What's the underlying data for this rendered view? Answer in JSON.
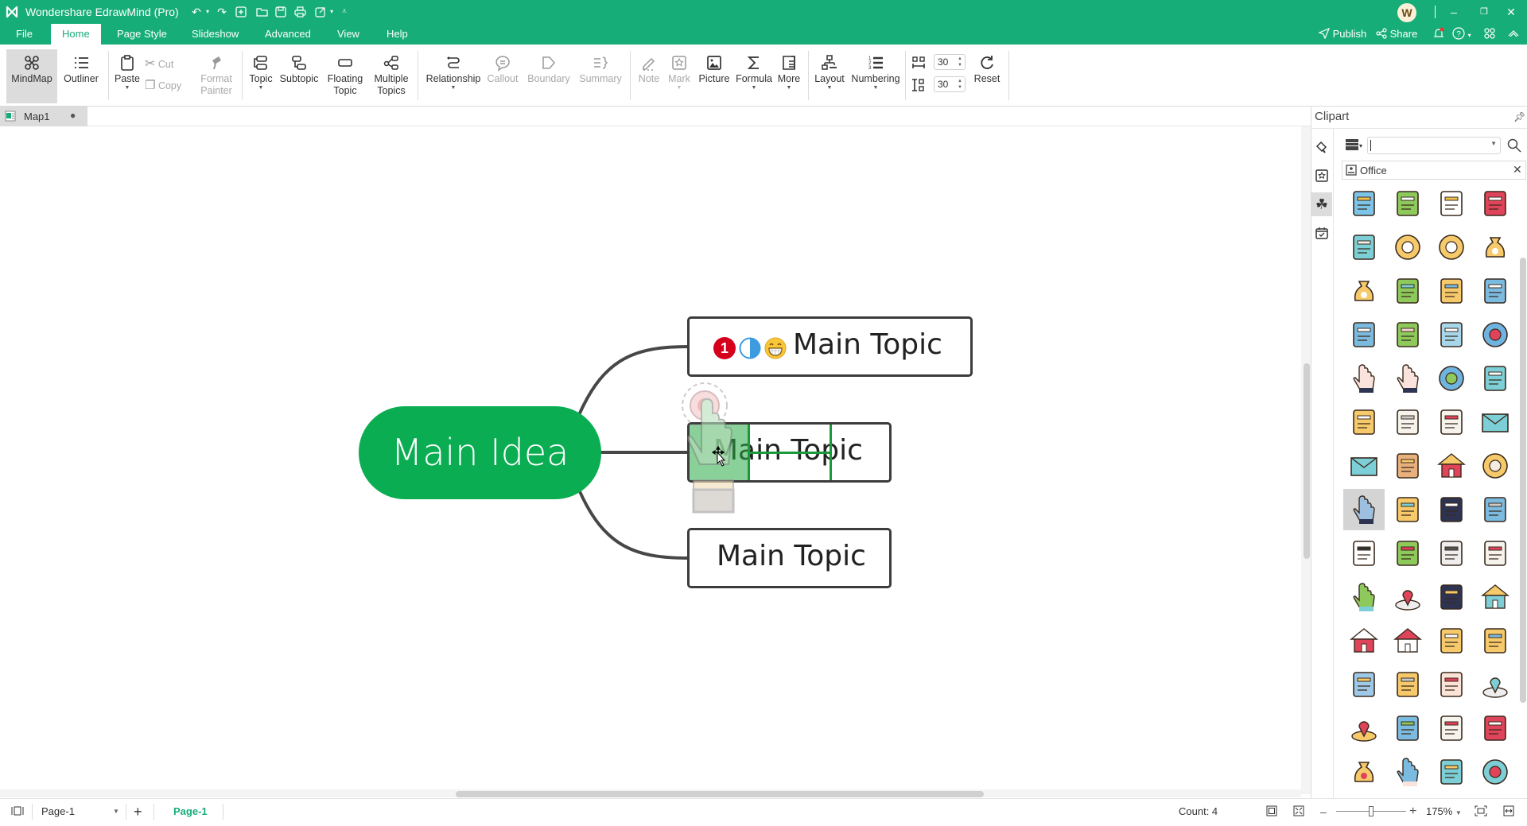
{
  "app": {
    "title": "Wondershare EdrawMind (Pro)",
    "accent_color": "#17ad79",
    "avatar_letter": "W"
  },
  "quick_access": [
    {
      "name": "undo-icon",
      "glyph": "↶"
    },
    {
      "name": "undo-dropdown-icon",
      "glyph": "▾"
    },
    {
      "name": "redo-icon",
      "glyph": "↷"
    },
    {
      "name": "new-icon",
      "glyph": "⊞"
    },
    {
      "name": "open-folder-icon",
      "glyph": "▭"
    },
    {
      "name": "save-icon",
      "glyph": "▣"
    },
    {
      "name": "print-icon",
      "glyph": "⎙"
    },
    {
      "name": "export-icon",
      "glyph": "↗"
    },
    {
      "name": "export-dropdown-icon",
      "glyph": "▾"
    },
    {
      "name": "customize-icon",
      "glyph": "⩡"
    }
  ],
  "menu": {
    "tabs": [
      "File",
      "Home",
      "Page Style",
      "Slideshow",
      "Advanced",
      "View",
      "Help"
    ],
    "active": "Home",
    "publish": "Publish",
    "share": "Share"
  },
  "ribbon": {
    "mindmap": "MindMap",
    "outliner": "Outliner",
    "paste": "Paste",
    "cut": "Cut",
    "copy": "Copy",
    "format_painter": [
      "Format",
      "Painter"
    ],
    "topic": "Topic",
    "subtopic": "Subtopic",
    "floating_topic": [
      "Floating",
      "Topic"
    ],
    "multiple_topics": [
      "Multiple",
      "Topics"
    ],
    "relationship": "Relationship",
    "callout": "Callout",
    "boundary": "Boundary",
    "summary": "Summary",
    "note": "Note",
    "mark": "Mark",
    "picture": "Picture",
    "formula": "Formula",
    "more": "More",
    "layout": "Layout",
    "numbering": "Numbering",
    "h_spacing": "30",
    "v_spacing": "30",
    "reset": "Reset"
  },
  "doc_tab": {
    "name": "Map1",
    "unsaved_dot": "●"
  },
  "mindmap": {
    "central": "Main Idea",
    "central_color": "#0bad52",
    "topics": [
      {
        "label": "Main Topic",
        "markers": [
          "priority-1",
          "progress-half",
          "grin-emoji"
        ],
        "priority_text": "1"
      },
      {
        "label": "Main Topic",
        "markers": [],
        "drop_target": true
      },
      {
        "label": "Main Topic",
        "markers": []
      }
    ]
  },
  "clipart": {
    "title": "Clipart",
    "search_value": "",
    "category": "Office",
    "items": [
      "id-badge",
      "glue-bottle",
      "resume",
      "stamp",
      "printer",
      "euro-coin",
      "yen-coin",
      "dollar-bag",
      "pound-bag",
      "desk-lamp",
      "pencil",
      "stapler",
      "binder-clip",
      "taxi",
      "airplane",
      "globe-stand",
      "thumbs-up",
      "thumbs-down",
      "earth",
      "mouse",
      "diamond",
      "document",
      "calendar",
      "open-envelope",
      "envelope",
      "briefcase",
      "shop",
      "alarm-clock",
      "touch-hand",
      "chat-bubbles",
      "smartphone",
      "scissors",
      "head-thinking",
      "t-shirt",
      "monitor",
      "laptop-heart",
      "hand-truck",
      "shopping-cart",
      "calculator",
      "warehouse",
      "bank",
      "house-yen",
      "currency-exchange",
      "contact-book",
      "scales",
      "lightbulb",
      "video-player",
      "map-pin-flat",
      "location-pin",
      "map",
      "folded-map",
      "price-tag",
      "shopping-bag",
      "handshake",
      "hourglass",
      "target"
    ],
    "selected_item": "touch-hand"
  },
  "status": {
    "page_selector": "Page-1",
    "active_page": "Page-1",
    "count": "Count: 4",
    "zoom": "175%",
    "zoom_fraction": 0.5
  }
}
